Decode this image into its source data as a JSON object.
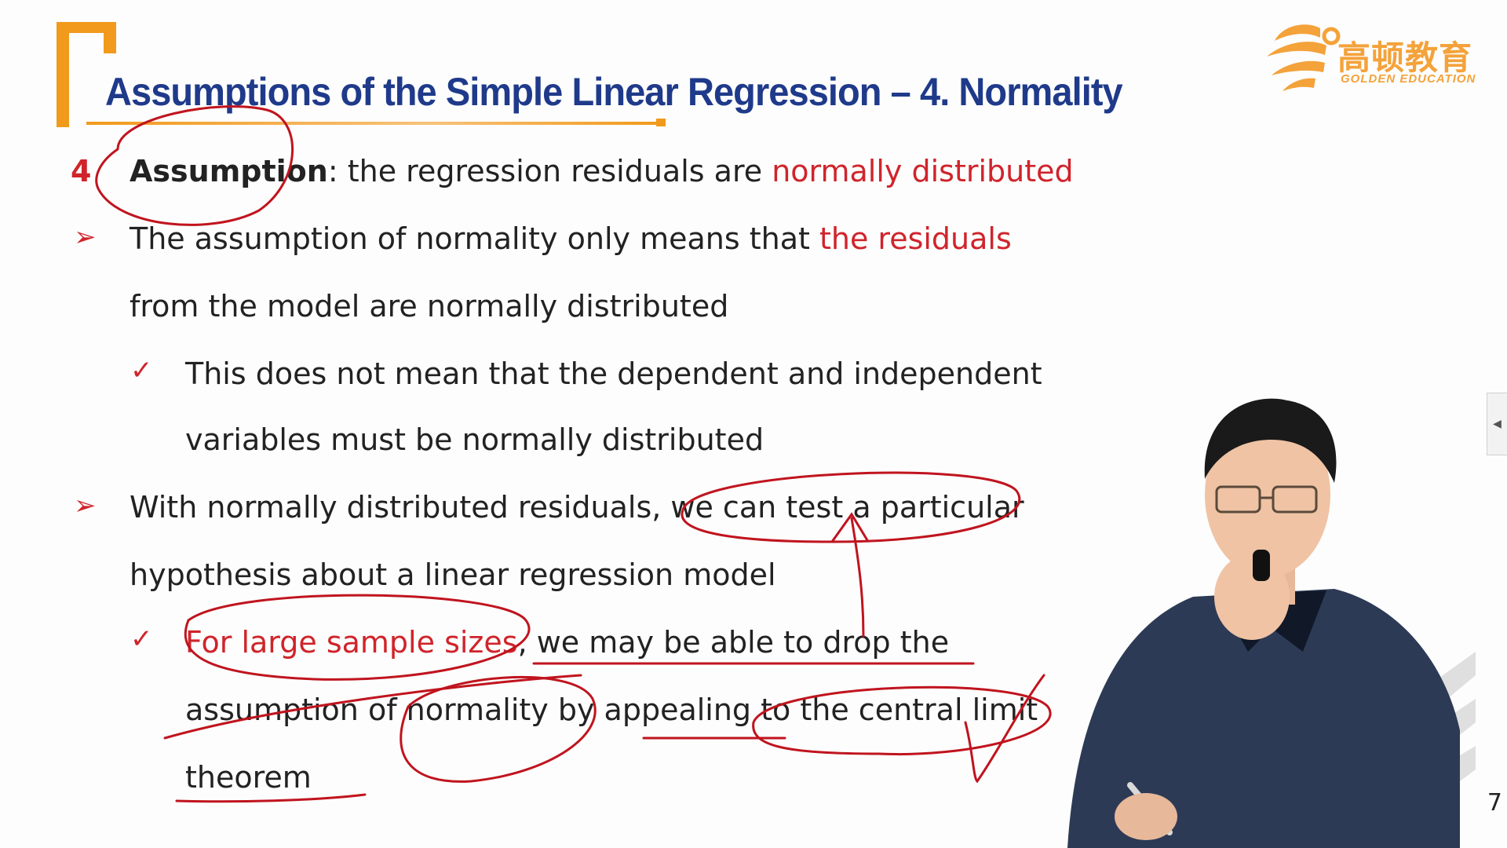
{
  "slide": {
    "title": "Assumptions of the Simple Linear Regression – 4. Normality",
    "number_marker": "4",
    "slide_number": "7"
  },
  "logo": {
    "cn_text": "高顿教育",
    "en_text": "GOLDEN EDUCATION"
  },
  "content": {
    "line1": {
      "bold": "Assumption",
      "normal": ": the regression residuals are ",
      "red": "normally distributed"
    },
    "line2": {
      "normal": "The assumption of normality only means that ",
      "red": "the residuals"
    },
    "line3": "from the model are normally distributed",
    "line4": "This does not mean that the dependent and independent",
    "line5": "variables must be normally distributed",
    "line6": "With normally distributed residuals, we can test a particular",
    "line7": "hypothesis about a linear regression model",
    "line8": {
      "red": "For large sample sizes",
      "normal": ", we may be able to drop the"
    },
    "line9": "assumption of normality by appealing to the central limit",
    "line10": "theorem"
  },
  "bullets": {
    "arrow": "➢",
    "check": "✓"
  },
  "side_tab": {
    "icon": "◀"
  },
  "colors": {
    "title_blue": "#1f3a8a",
    "accent_orange": "#f29a1c",
    "highlight_red": "#d0242b",
    "annotation_red": "#c0141e"
  }
}
